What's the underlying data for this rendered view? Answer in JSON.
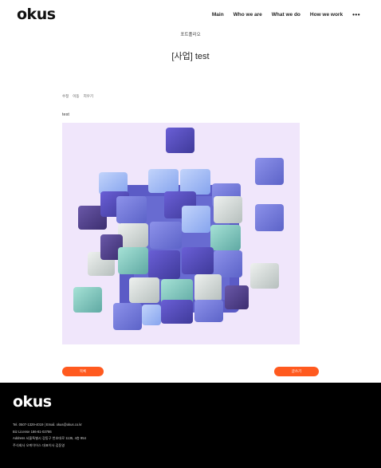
{
  "header": {
    "logo": "okus",
    "nav": [
      "Main",
      "Who we are",
      "What we do",
      "How we work"
    ],
    "more": "•••"
  },
  "page": {
    "breadcrumb": "포트폴리오",
    "title": "[사업] test",
    "actions": [
      "수정",
      "이동",
      "지우기"
    ],
    "body_text": "test"
  },
  "figure": {
    "subject": "3D cube cluster illustration",
    "background": "#f0e6fb",
    "palette": [
      "#5a56c8",
      "#7c74e0",
      "#9fb0f0",
      "#7fc8c0",
      "#c9d2d0",
      "#4b3a8a"
    ]
  },
  "buttons": {
    "list_label": "목록",
    "write_label": "글쓰기",
    "color": "#ff5a1f"
  },
  "footer": {
    "logo": "okus",
    "lines": [
      "Tel. 0507-1329-4019 | Email. okus@okus.co.kr",
      "Biz License 186-81-02786",
      "Address 서울특별시 강동구 천호대로 1135, 4층 954",
      "주식회사 오케이어스 대표이사 김동영"
    ]
  }
}
